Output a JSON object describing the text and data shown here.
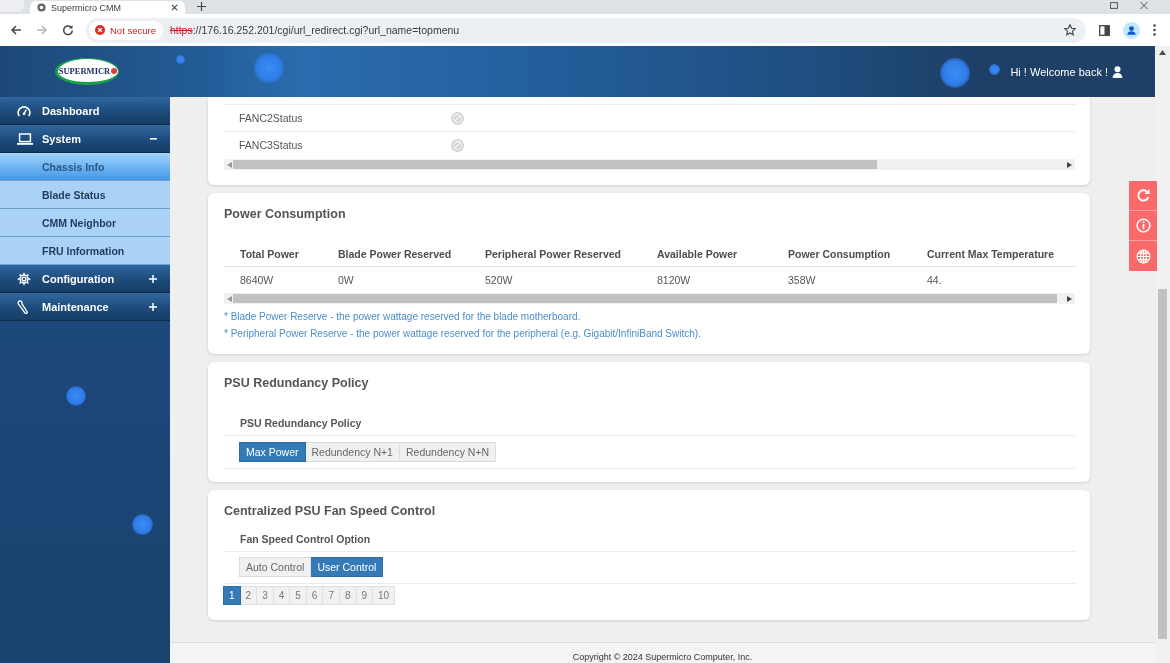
{
  "browser": {
    "tab_title": "Supermicro CMM",
    "nav_buttons": [
      {
        "kind": "back",
        "disabled": false
      },
      {
        "kind": "forward",
        "disabled": true
      },
      {
        "kind": "reload",
        "disabled": false
      }
    ],
    "security_label": "Not secure",
    "url_scheme": "https",
    "url_rest": "://176.16.252.201/cgi/url_redirect.cgi?url_name=topmenu"
  },
  "header": {
    "logo_text": "SUPERMICR",
    "greeting": "Hi ! Welcome back !"
  },
  "sidebar": {
    "items": [
      {
        "kind": "link",
        "label": "Dashboard"
      },
      {
        "kind": "group",
        "label": "System",
        "expanded": true,
        "children": [
          {
            "label": "Chassis Info",
            "selected": true
          },
          {
            "label": "Blade Status",
            "selected": false
          },
          {
            "label": "CMM Neighbor",
            "selected": false
          },
          {
            "label": "FRU Information",
            "selected": false
          }
        ]
      },
      {
        "kind": "group",
        "label": "Configuration",
        "expanded": false
      },
      {
        "kind": "group",
        "label": "Maintenance",
        "expanded": false
      }
    ]
  },
  "fan_status": {
    "rows": [
      {
        "name": "FANC2Status",
        "available": false
      },
      {
        "name": "FANC3Status",
        "available": false
      }
    ]
  },
  "power_consumption": {
    "title": "Power Consumption",
    "columns": [
      "Total Power",
      "Blade Power Reserved",
      "Peripheral Power Reserved",
      "Available Power",
      "Power Consumption",
      "Current Max Temperature"
    ],
    "rows": [
      [
        "8640W",
        "0W",
        "520W",
        "8120W",
        "358W",
        "44."
      ]
    ],
    "notes": [
      "* Blade Power Reserve - the power wattage reserved for the blade motherboard.",
      "* Peripheral Power Reserve - the power wattage reserved for the peripheral (e.g. Gigabit/InfiniBand Switch)."
    ]
  },
  "psu_redundancy": {
    "title": "PSU Redundancy Policy",
    "label": "PSU Redundancy Policy",
    "options": [
      {
        "label": "Max Power",
        "selected": true
      },
      {
        "label": "Redundency N+1",
        "selected": false
      },
      {
        "label": "Redundency N+N",
        "selected": false
      }
    ]
  },
  "fan_speed_control": {
    "title": "Centralized PSU Fan Speed Control",
    "label": "Fan Speed Control Option",
    "options": [
      {
        "label": "Auto Control",
        "selected": false
      },
      {
        "label": "User Control",
        "selected": true
      }
    ],
    "pages": [
      {
        "label": "1",
        "selected": true
      },
      {
        "label": "2",
        "selected": false
      },
      {
        "label": "3",
        "selected": false
      },
      {
        "label": "4",
        "selected": false
      },
      {
        "label": "5",
        "selected": false
      },
      {
        "label": "6",
        "selected": false
      },
      {
        "label": "7",
        "selected": false
      },
      {
        "label": "8",
        "selected": false
      },
      {
        "label": "9",
        "selected": false
      },
      {
        "label": "10",
        "selected": false
      }
    ]
  },
  "footer": {
    "copyright": "Copyright © 2024 Supermicro Computer, Inc."
  }
}
